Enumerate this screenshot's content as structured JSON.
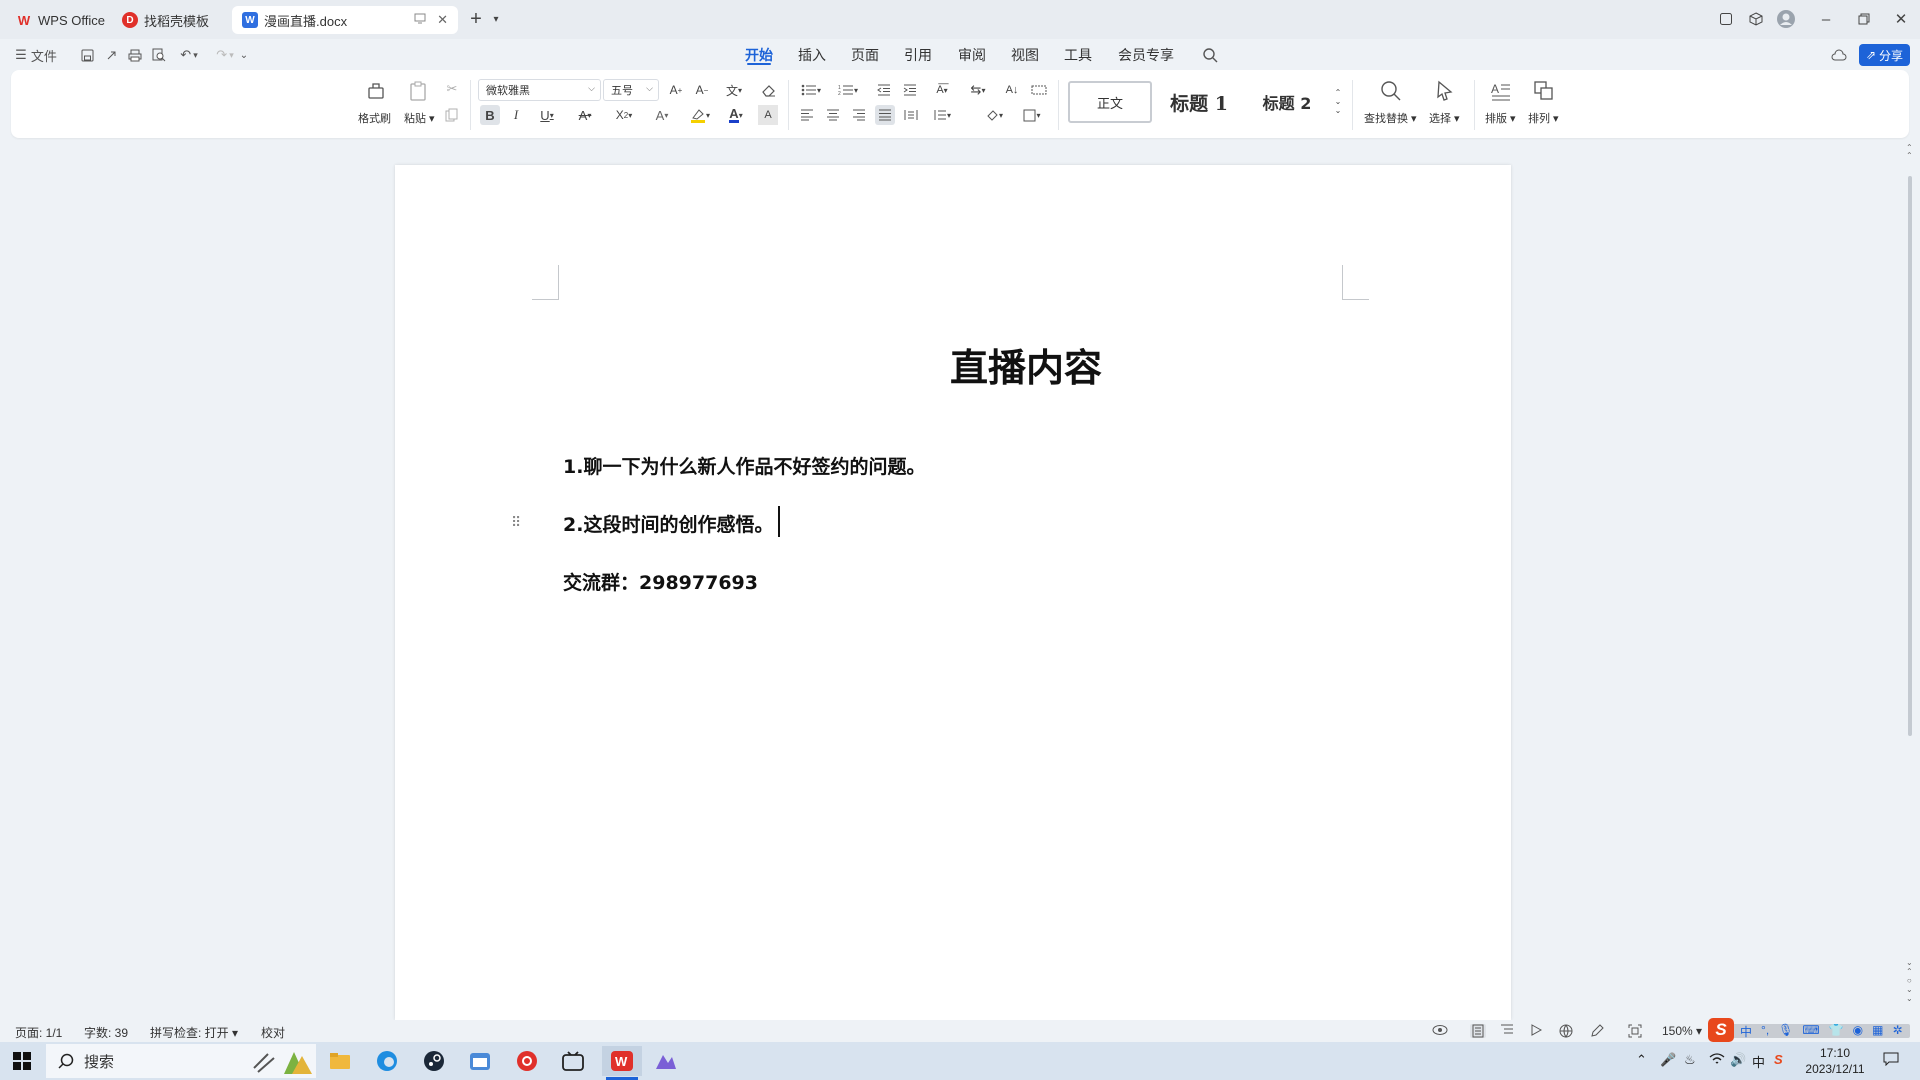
{
  "titlebar": {
    "tabs": [
      {
        "label": "WPS Office",
        "icon": "wps-logo-icon"
      },
      {
        "label": "找稻壳模板",
        "icon": "docer-icon"
      },
      {
        "label": "漫画直播.docx",
        "icon": "word-doc-icon"
      }
    ]
  },
  "menubar": {
    "file_label": "文件",
    "tabs": [
      "开始",
      "插入",
      "页面",
      "引用",
      "审阅",
      "视图",
      "工具",
      "会员专享"
    ],
    "active_tab": "开始",
    "share_label": "分享"
  },
  "ribbon": {
    "format_painter": "格式刷",
    "paste": "粘贴",
    "font_name": "微软雅黑",
    "font_size": "五号",
    "styles": [
      "正文",
      "标题 1",
      "标题 2"
    ],
    "find_replace": "查找替换",
    "select": "选择",
    "layout": "排版",
    "arrange": "排列"
  },
  "document": {
    "title": "直播内容",
    "lines": [
      "1.聊一下为什么新人作品不好签约的问题。",
      "2.这段时间的创作感悟。",
      "交流群：298977693"
    ]
  },
  "statusbar": {
    "page": "页面: 1/1",
    "word_count": "字数: 39",
    "spellcheck": "拼写检查: 打开",
    "proofread": "校对",
    "zoom": "150%"
  },
  "taskbar": {
    "search_placeholder": "搜索",
    "ime": "中",
    "time": "17:10",
    "date": "2023/12/11"
  },
  "colors": {
    "accent": "#1d63d8",
    "wps_red": "#e0302a",
    "page_bg": "#eef2f6"
  }
}
